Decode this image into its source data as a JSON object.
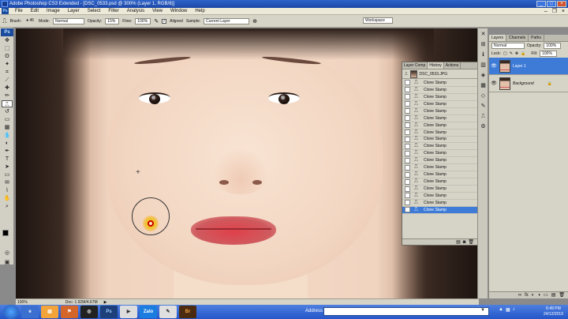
{
  "window": {
    "title": "Adobe Photoshop CS3 Extended - [DSC_0533.psd @ 300% (Layer 1, RGB/8)]"
  },
  "menu": [
    "File",
    "Edit",
    "Image",
    "Layer",
    "Select",
    "Filter",
    "Analysis",
    "View",
    "Window",
    "Help"
  ],
  "options": {
    "brush_label": "Brush:",
    "brush_size": "46",
    "mode_label": "Mode:",
    "mode_value": "Normal",
    "opacity_label": "Opacity:",
    "opacity_value": "15%",
    "flow_label": "Flow:",
    "flow_value": "100%",
    "aligned_label": "Aligned",
    "sample_label": "Sample:",
    "sample_value": "Current Layer",
    "workspace_label": "Workspace"
  },
  "status": {
    "zoom": "100%",
    "doc": "Doc: 1.92M/4.67M"
  },
  "history": {
    "tabs": [
      "Layer Comp",
      "History",
      "Actions"
    ],
    "snapshot": "DSC_0533.JPG",
    "items": [
      "Clone Stamp",
      "Clone Stamp",
      "Clone Stamp",
      "Clone Stamp",
      "Clone Stamp",
      "Clone Stamp",
      "Clone Stamp",
      "Clone Stamp",
      "Clone Stamp",
      "Clone Stamp",
      "Clone Stamp",
      "Clone Stamp",
      "Clone Stamp",
      "Clone Stamp",
      "Clone Stamp",
      "Clone Stamp",
      "Clone Stamp",
      "Clone Stamp",
      "Clone Stamp"
    ],
    "active_item": "Clone Stamp"
  },
  "layers": {
    "tabs": [
      "Layers",
      "Channels",
      "Paths"
    ],
    "blend_mode": "Normal",
    "opacity_label": "Opacity:",
    "opacity_value": "100%",
    "lock_label": "Lock:",
    "fill_label": "Fill:",
    "fill_value": "100%",
    "items": [
      {
        "name": "Layer 1",
        "active": true
      },
      {
        "name": "Background",
        "active": false
      }
    ]
  },
  "taskbar": {
    "address_label": "Address",
    "time": "6:49 PM",
    "date": "24/12/2019"
  }
}
